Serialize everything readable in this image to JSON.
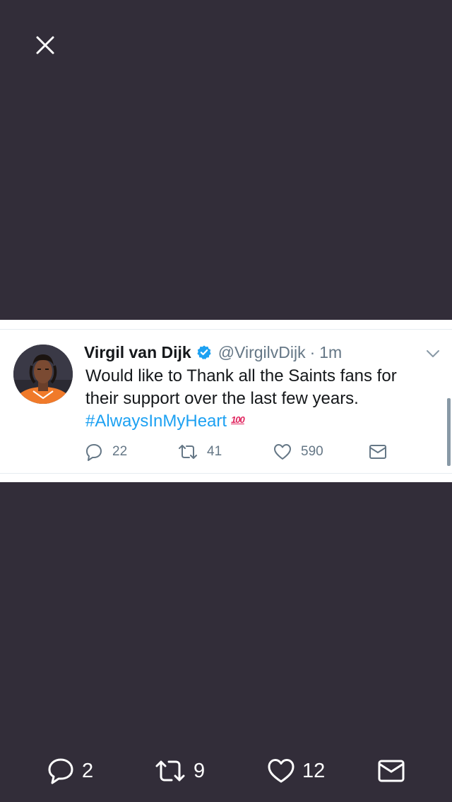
{
  "close_icon": "close-icon",
  "tweet": {
    "display_name": "Virgil van Dijk",
    "verified_icon": "verified-badge-icon",
    "handle": "@VirgilvDijk",
    "separator": "·",
    "time": "1m",
    "text_line1": "Would like to Thank all the Saints fans for",
    "text_line2": "their support over the last few years.",
    "hashtag": "#AlwaysInMyHeart",
    "emoji": "100",
    "emoji_icon": "hundred-points-emoji",
    "replies": "22",
    "retweets": "41",
    "likes": "590"
  },
  "bottom_bar": {
    "replies": "2",
    "retweets": "9",
    "likes": "12"
  },
  "colors": {
    "background": "#322d39",
    "link": "#1da1f2",
    "secondary_text": "#657786",
    "emoji_red": "#e0245e"
  }
}
